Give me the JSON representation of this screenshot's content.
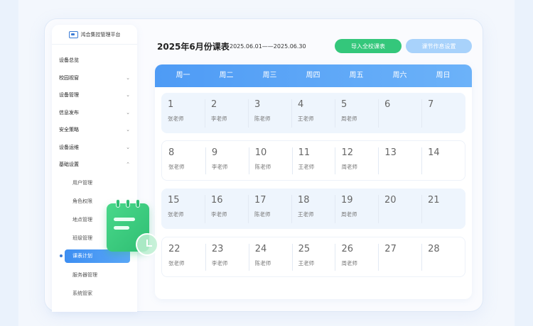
{
  "brand": {
    "name": "鸿合集控管理平台"
  },
  "sidebar": {
    "items": [
      {
        "label": "设备总览",
        "chevron": ""
      },
      {
        "label": "校园视窗",
        "chevron": "⌄"
      },
      {
        "label": "设备管理",
        "chevron": "⌄"
      },
      {
        "label": "信息发布",
        "chevron": "⌄"
      },
      {
        "label": "安全策略",
        "chevron": "⌄"
      },
      {
        "label": "设备运维",
        "chevron": "⌄"
      },
      {
        "label": "基础设置",
        "chevron": "⌃"
      }
    ],
    "subitems": [
      {
        "label": "用户管理"
      },
      {
        "label": "角色权限"
      },
      {
        "label": "地点管理"
      },
      {
        "label": "班级管理"
      },
      {
        "label": "课表计划"
      },
      {
        "label": "服务器管理"
      },
      {
        "label": "系统管家"
      }
    ]
  },
  "header": {
    "title": "2025年6月份课表",
    "date_range": "2025.06.01——2025.06.30",
    "import_button": "导入全校课表",
    "schedule_button": "课节作息设置"
  },
  "calendar": {
    "weekdays": [
      "周一",
      "周二",
      "周三",
      "周四",
      "周五",
      "周六",
      "周日"
    ],
    "weeks": [
      [
        {
          "day": "1",
          "teacher": "张老师"
        },
        {
          "day": "2",
          "teacher": "李老师"
        },
        {
          "day": "3",
          "teacher": "陈老师"
        },
        {
          "day": "4",
          "teacher": "王老师"
        },
        {
          "day": "5",
          "teacher": "周老师"
        },
        {
          "day": "6",
          "teacher": ""
        },
        {
          "day": "7",
          "teacher": ""
        }
      ],
      [
        {
          "day": "8",
          "teacher": "张老师"
        },
        {
          "day": "9",
          "teacher": "李老师"
        },
        {
          "day": "10",
          "teacher": "陈老师"
        },
        {
          "day": "11",
          "teacher": "王老师"
        },
        {
          "day": "12",
          "teacher": "周老师"
        },
        {
          "day": "13",
          "teacher": ""
        },
        {
          "day": "14",
          "teacher": ""
        }
      ],
      [
        {
          "day": "15",
          "teacher": "张老师"
        },
        {
          "day": "16",
          "teacher": "李老师"
        },
        {
          "day": "17",
          "teacher": "陈老师"
        },
        {
          "day": "18",
          "teacher": "王老师"
        },
        {
          "day": "19",
          "teacher": "周老师"
        },
        {
          "day": "20",
          "teacher": ""
        },
        {
          "day": "21",
          "teacher": ""
        }
      ],
      [
        {
          "day": "22",
          "teacher": "张老师"
        },
        {
          "day": "23",
          "teacher": "李老师"
        },
        {
          "day": "24",
          "teacher": "陈老师"
        },
        {
          "day": "25",
          "teacher": "王老师"
        },
        {
          "day": "26",
          "teacher": "周老师"
        },
        {
          "day": "27",
          "teacher": ""
        },
        {
          "day": "28",
          "teacher": ""
        }
      ]
    ]
  },
  "colors": {
    "accent": "#4e9bf5",
    "import_green": "#34c77b",
    "schedule_blue": "#a8d2fb"
  },
  "icons": {
    "brand_logo": "platform-logo-icon",
    "floating": "calendar-clock-icon"
  }
}
